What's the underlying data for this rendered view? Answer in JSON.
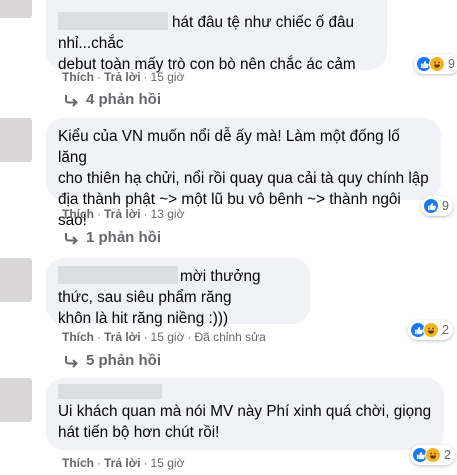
{
  "comments": [
    {
      "text": "hát đâu tệ như chiếc ố đâu nhỉ...chắc debut toàn mấy trò con bò nên chắc ác cảm",
      "line1": "hát đâu tệ như chiếc ố đâu nhỉ...chắc",
      "line2": "debut toàn mấy trò con bò nên chắc ác cảm",
      "like_label": "Thích",
      "reply_label": "Trả lời",
      "time": "15 giờ",
      "edited": "",
      "reactions": [
        "like",
        "haha"
      ],
      "reaction_count": "9",
      "replies_label": "4 phản hồi"
    },
    {
      "line1": "Kiểu của VN muốn nổi dễ ấy mà! Làm một đống lố lăng",
      "line2": "cho thiên hạ chửi, nổi rồi quay qua cải tà quy chính lập",
      "line3": "địa thành phật ~> một lũ bu vô bênh ~> thành ngôi sao!",
      "like_label": "Thích",
      "reply_label": "Trả lời",
      "time": "13 giờ",
      "reactions": [
        "like"
      ],
      "reaction_count": "9",
      "replies_label": "1 phản hồi"
    },
    {
      "line1": "mời thưởng thức, sau siêu phẩm răng",
      "line2": "khôn là hit răng niềng :)))",
      "like_label": "Thích",
      "reply_label": "Trả lời",
      "time": "15 giờ",
      "edited": "Đã chỉnh sửa",
      "reactions": [
        "like",
        "haha"
      ],
      "reaction_count": "2",
      "replies_label": "5 phản hồi"
    },
    {
      "line1": "Ui khách quan mà nói MV này Phí xinh quá chời, giọng",
      "line2": "hát tiến bộ hơn chút rồi!",
      "like_label": "Thích",
      "reply_label": "Trả lời",
      "time": "15 giờ",
      "reactions": [
        "like",
        "haha"
      ],
      "reaction_count": "2"
    }
  ],
  "colors": {
    "bubble": "#f0f2f5",
    "meta_text": "#65676b",
    "like": "#1877f2",
    "haha": "#f7b125"
  }
}
